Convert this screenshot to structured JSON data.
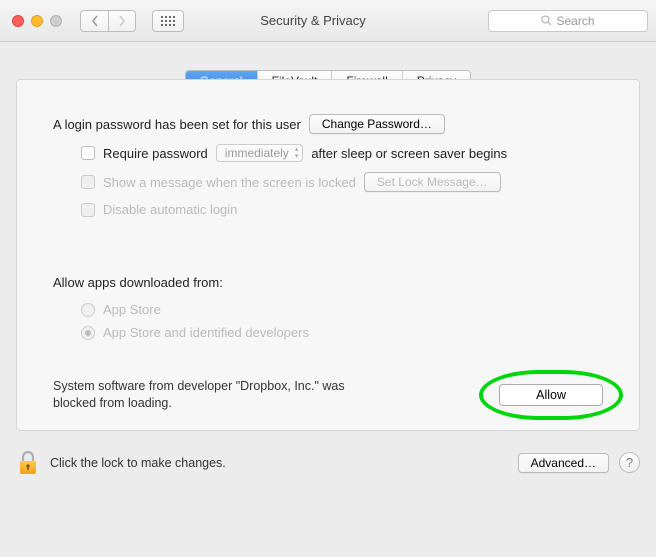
{
  "window": {
    "title": "Security & Privacy",
    "search_placeholder": "Search"
  },
  "tabs": {
    "general": "General",
    "filevault": "FileVault",
    "firewall": "Firewall",
    "privacy": "Privacy",
    "active": "general"
  },
  "login": {
    "password_set_text": "A login password has been set for this user",
    "change_password_btn": "Change Password…",
    "require_password_label": "Require password",
    "require_password_when": "immediately",
    "require_password_tail": "after sleep or screen saver begins",
    "show_message_label": "Show a message when the screen is locked",
    "set_lock_message_btn": "Set Lock Message…",
    "disable_auto_login_label": "Disable automatic login"
  },
  "downloads": {
    "title": "Allow apps downloaded from:",
    "option1": "App Store",
    "option2": "App Store and identified developers",
    "selected": "option2"
  },
  "blocked": {
    "message": "System software from developer \"Dropbox, Inc.\" was blocked from loading.",
    "allow_btn": "Allow"
  },
  "footer": {
    "lock_message": "Click the lock to make changes.",
    "advanced_btn": "Advanced…"
  }
}
